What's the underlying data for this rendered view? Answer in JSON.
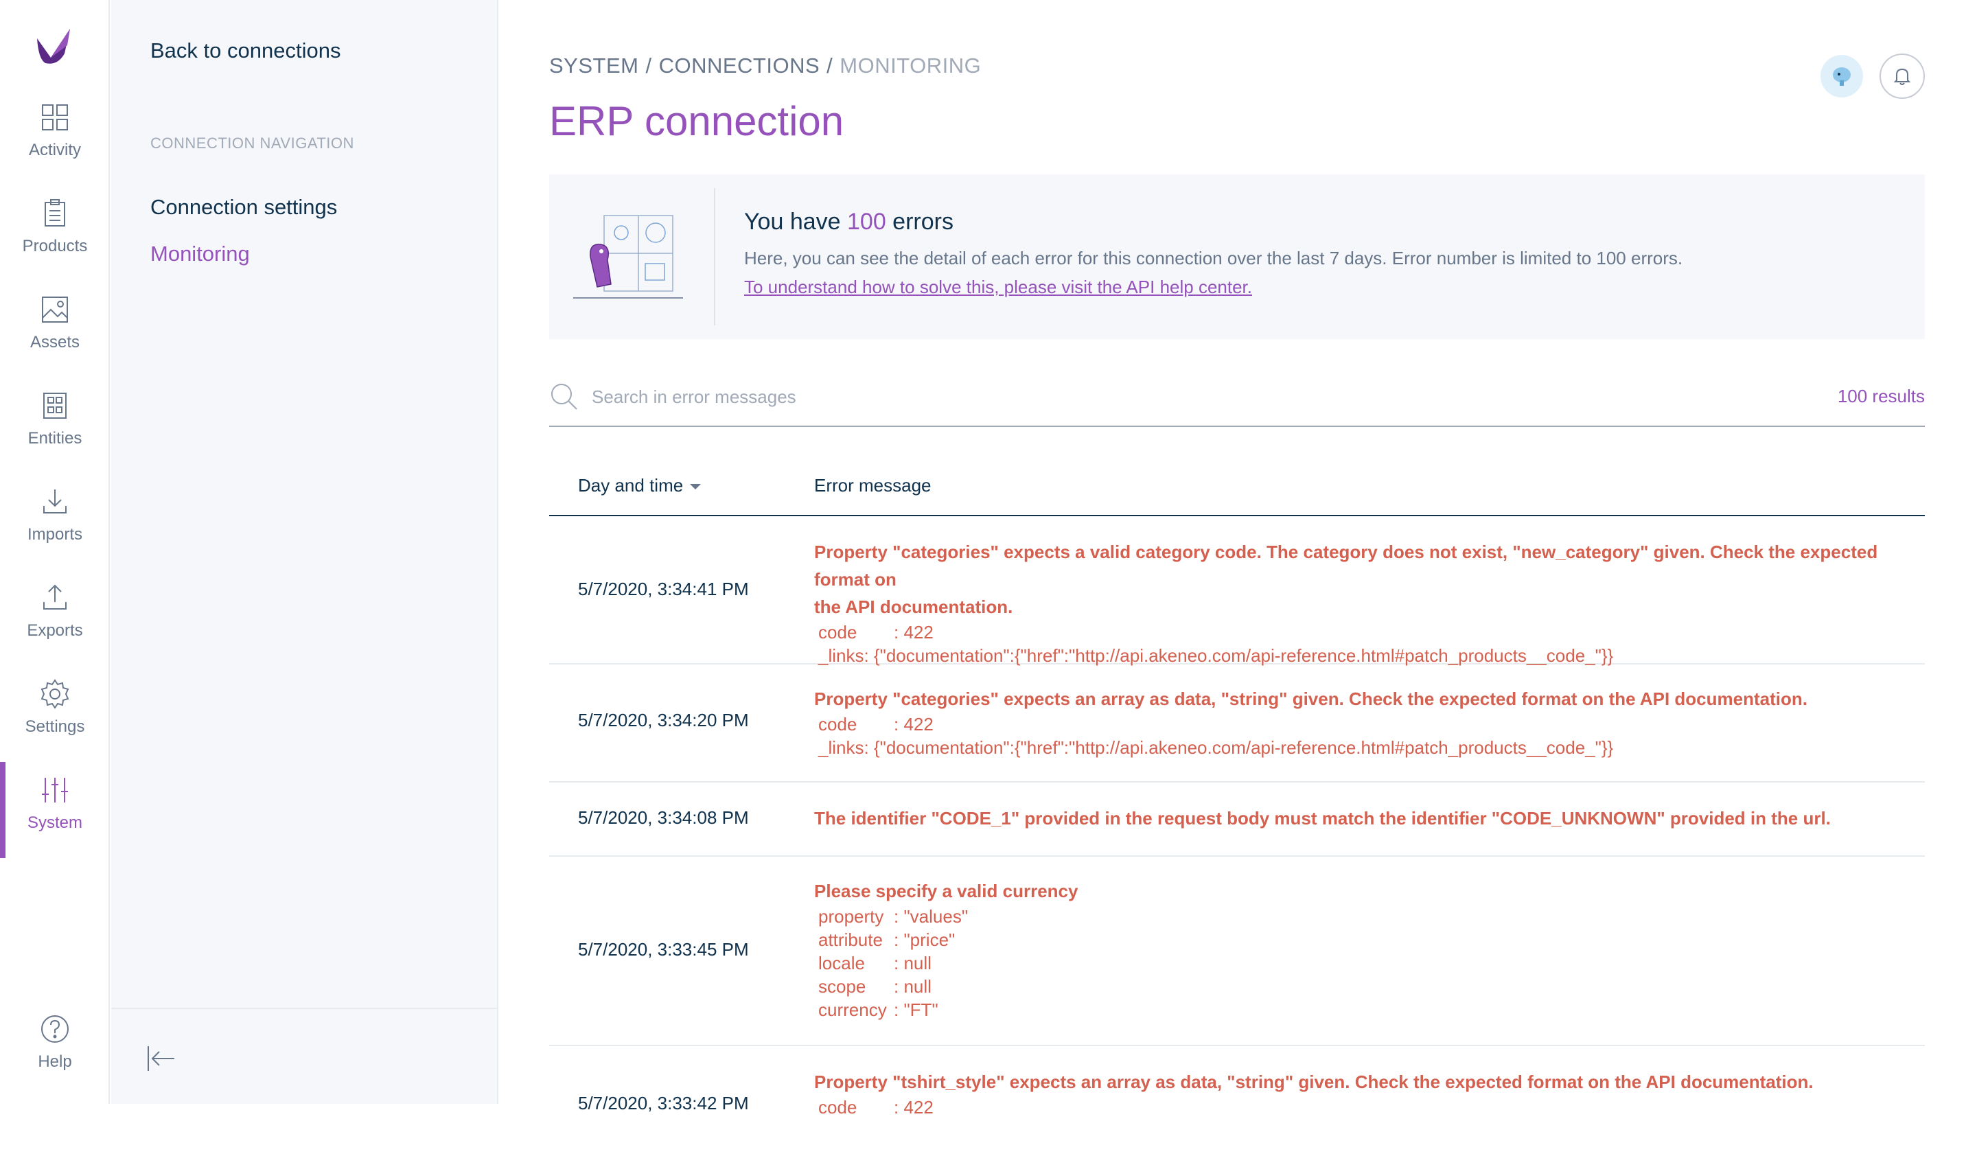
{
  "rail": {
    "items": [
      {
        "label": "Activity",
        "icon": "activity-icon"
      },
      {
        "label": "Products",
        "icon": "products-icon"
      },
      {
        "label": "Assets",
        "icon": "assets-icon"
      },
      {
        "label": "Entities",
        "icon": "entities-icon"
      },
      {
        "label": "Imports",
        "icon": "imports-icon"
      },
      {
        "label": "Exports",
        "icon": "exports-icon"
      },
      {
        "label": "Settings",
        "icon": "settings-icon"
      },
      {
        "label": "System",
        "icon": "system-icon",
        "active": true
      }
    ],
    "help": {
      "label": "Help",
      "icon": "help-icon"
    }
  },
  "panel": {
    "back": "Back to connections",
    "section": "CONNECTION NAVIGATION",
    "links": [
      {
        "label": "Connection settings"
      },
      {
        "label": "Monitoring",
        "active": true
      }
    ]
  },
  "header": {
    "breadcrumb": [
      "SYSTEM",
      "CONNECTIONS",
      "MONITORING"
    ],
    "sep": "/",
    "title": "ERP connection"
  },
  "helper": {
    "title_prefix": "You have ",
    "count": "100",
    "title_suffix": " errors",
    "description": "Here, you can see the detail of each error for this connection over the last 7 days. Error number is limited to 100 errors.",
    "link": "To understand how to solve this, please visit the API help center."
  },
  "search": {
    "placeholder": "Search in error messages",
    "value": "",
    "results": "100 results"
  },
  "table": {
    "columns": {
      "date": "Day and time",
      "message": "Error message"
    },
    "rows": [
      {
        "date": "5/7/2020, 3:34:41 PM",
        "message": [
          "Property \"categories\" expects a valid category code. The category does not exist, \"new_category\" given. Check the expected format on",
          "the API documentation."
        ],
        "details": [
          {
            "key": "code",
            "value": ": 422"
          },
          {
            "key": "_links",
            "value": ": {\"documentation\":{\"href\":\"http://api.akeneo.com/api-reference.html#patch_products__code_\"}}"
          }
        ]
      },
      {
        "date": "5/7/2020, 3:34:20 PM",
        "message": [
          "Property \"categories\" expects an array as data, \"string\" given. Check the expected format on the API documentation."
        ],
        "details": [
          {
            "key": "code",
            "value": ": 422"
          },
          {
            "key": "_links",
            "value": ": {\"documentation\":{\"href\":\"http://api.akeneo.com/api-reference.html#patch_products__code_\"}}"
          }
        ]
      },
      {
        "date": "5/7/2020, 3:34:08 PM",
        "message": [
          "The identifier \"CODE_1\" provided in the request body must match the identifier \"CODE_UNKNOWN\" provided in the url."
        ],
        "details": []
      },
      {
        "date": "5/7/2020, 3:33:45 PM",
        "message": [
          "Please specify a valid currency"
        ],
        "details": [
          {
            "key": "property",
            "value": ": \"values\""
          },
          {
            "key": "attribute",
            "value": ": \"price\""
          },
          {
            "key": "locale",
            "value": ": null"
          },
          {
            "key": "scope",
            "value": ": null"
          },
          {
            "key": "currency",
            "value": ": \"FT\""
          }
        ]
      },
      {
        "date": "5/7/2020, 3:33:42 PM",
        "message": [
          "Property \"tshirt_style\" expects an array as data, \"string\" given. Check the expected format on the API documentation."
        ],
        "details": [
          {
            "key": "code",
            "value": ": 422"
          }
        ]
      }
    ]
  },
  "colors": {
    "accent": "#9452ba",
    "error": "#d4604f",
    "text": "#11324d",
    "muted": "#67768a"
  }
}
